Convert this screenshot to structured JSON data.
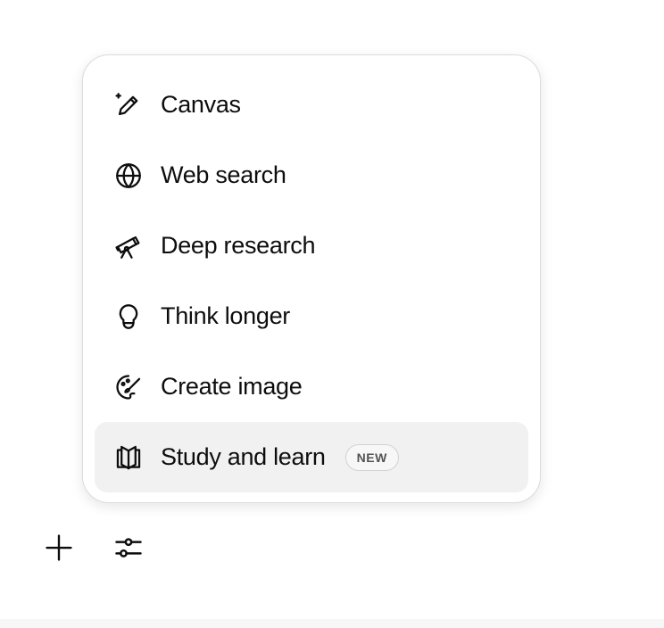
{
  "menu": {
    "items": [
      {
        "label": "Canvas",
        "icon": "canvas-pencil-sparkle-icon"
      },
      {
        "label": "Web search",
        "icon": "globe-icon"
      },
      {
        "label": "Deep research",
        "icon": "telescope-icon"
      },
      {
        "label": "Think longer",
        "icon": "lightbulb-icon"
      },
      {
        "label": "Create image",
        "icon": "palette-brush-icon"
      },
      {
        "label": "Study and learn",
        "icon": "open-book-icon",
        "badge": "NEW",
        "highlighted": true
      }
    ]
  },
  "toolbar": {
    "add_icon": "plus-icon",
    "tools_icon": "sliders-icon"
  },
  "colors": {
    "text": "#0d0d0d",
    "highlight": "#f1f1f1",
    "border": "#dcdcdc"
  }
}
